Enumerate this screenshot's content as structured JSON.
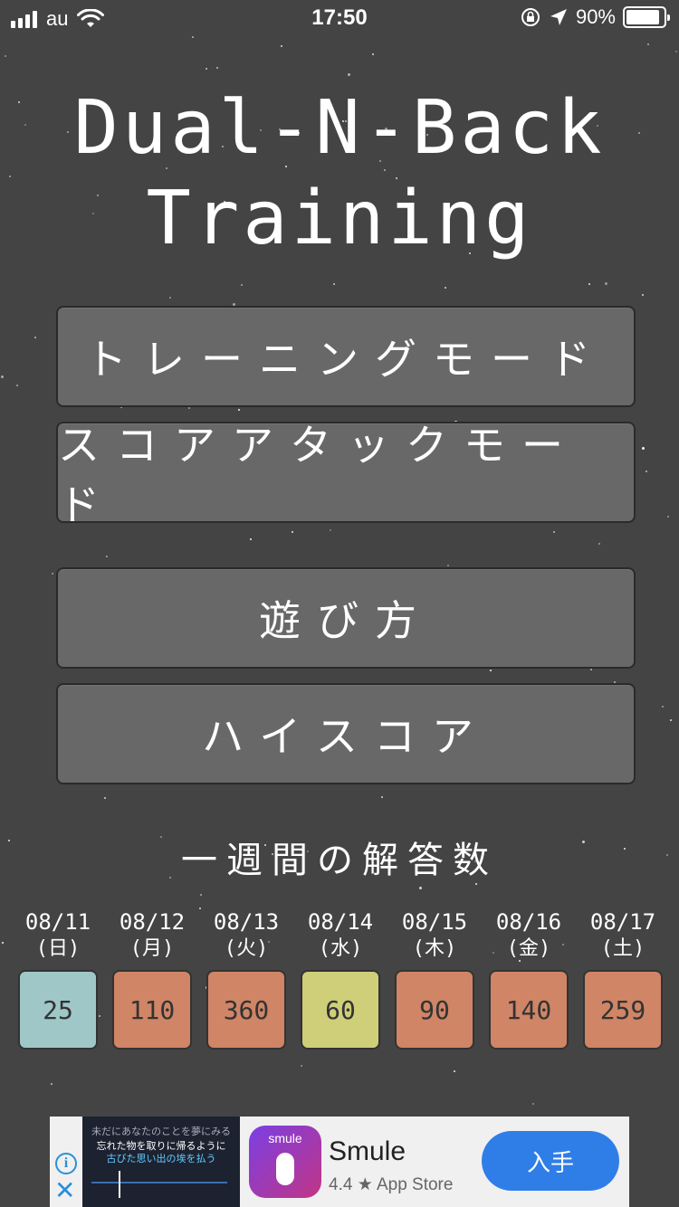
{
  "status_bar": {
    "carrier": "au",
    "time": "17:50",
    "battery_percent": "90%",
    "battery_level": 0.9
  },
  "app": {
    "title_line1": "Dual-N-Back",
    "title_line2": "Training"
  },
  "menu": {
    "training_mode": "トレーニングモード",
    "score_attack_mode": "スコアアタックモード",
    "how_to_play": "遊び方",
    "high_score": "ハイスコア"
  },
  "weekly": {
    "title": "一週間の解答数",
    "days": [
      {
        "date": "08/11",
        "dow": "(日)",
        "count": "25",
        "color": "#9fc7c7"
      },
      {
        "date": "08/12",
        "dow": "(月)",
        "count": "110",
        "color": "#cf8566"
      },
      {
        "date": "08/13",
        "dow": "(火)",
        "count": "360",
        "color": "#cf8566"
      },
      {
        "date": "08/14",
        "dow": "(水)",
        "count": "60",
        "color": "#cfcf7a"
      },
      {
        "date": "08/15",
        "dow": "(木)",
        "count": "90",
        "color": "#cf8566"
      },
      {
        "date": "08/16",
        "dow": "(金)",
        "count": "140",
        "color": "#cf8566"
      },
      {
        "date": "08/17",
        "dow": "(土)",
        "count": "259",
        "color": "#cf8566"
      }
    ]
  },
  "ad": {
    "thumb_line1": "未だにあなたのことを夢にみる",
    "thumb_line2": "忘れた物を取りに帰るように",
    "thumb_line3": "古びた思い出の埃を払う",
    "icon_label": "smule",
    "app_name": "Smule",
    "rating": "4.4 ★ App Store",
    "cta": "入手"
  },
  "icons": [
    "signal-icon",
    "wifi-icon",
    "orientation-lock-icon",
    "location-arrow-icon",
    "battery-icon",
    "info-icon",
    "close-icon"
  ]
}
